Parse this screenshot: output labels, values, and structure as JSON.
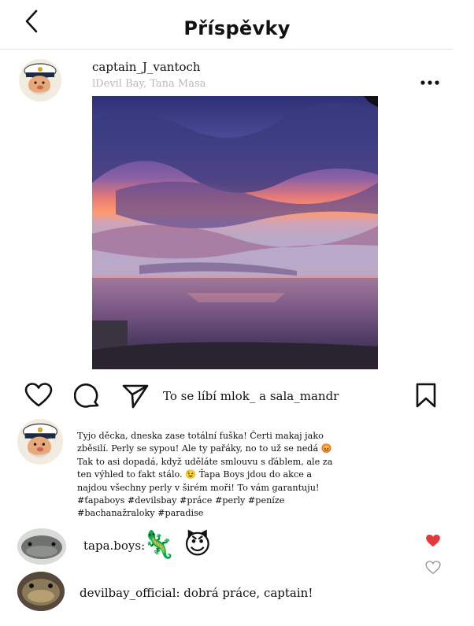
{
  "header": {
    "title": "Příspěvky",
    "back_icon": "chevron-left-icon"
  },
  "post": {
    "username": "captain_J_vantoch",
    "location": "lDevil Bay, Tana Masa",
    "more_icon": "more-dots-icon",
    "actions": [
      "heart-icon",
      "comment-icon",
      "share-icon",
      "bookmark-icon"
    ],
    "liked_by": "To se líbí mlok_ a sala_mandr",
    "caption_lines": [
      "Tyjo děcka, dneska zase totální fuška!  Čerti makaj jako",
      "zběsilí. Perly se sypou! Ale ty pařáky, no to už se nedá 😡",
      "Tak to asi dopadá, když uděláte smlouvu s ďáblem, ale za",
      "ten výhled to fakt stálo. 😉 Ťapa Boys jdou do akce a",
      "najdou všechny perly v širém moři! To vám garantuju!",
      "#ťapaboys #devilsbay #práce #perly #peníze",
      "#bachanažraloky #paradise"
    ]
  },
  "comments": [
    {
      "text": "tapa.boys:",
      "emoji": "🦎 😈",
      "liked": true
    },
    {
      "text": "devilbay_official: dobrá práce, captain!",
      "liked": false
    }
  ],
  "colors": {
    "heart_liked": "#e5383b",
    "location": "#b9b9b9",
    "divider": "#e2e2e2"
  }
}
